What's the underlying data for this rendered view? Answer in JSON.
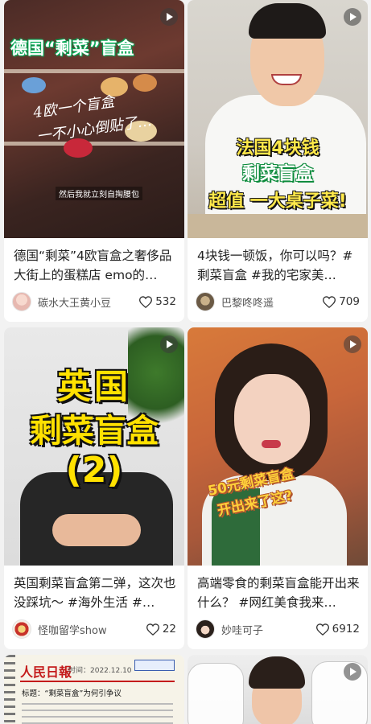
{
  "feed": {
    "cards": [
      {
        "title": "德国“剩菜”4欧盲盒之奢侈品大街上的蛋糕店 emo的…",
        "author": "碳水大王黄小豆",
        "likes": "532",
        "thumb_text": {
          "headline": "德国“剩菜”盲盒",
          "note_line1": "4欧一个盲盒",
          "note_line2": "一不小心倒贴了…",
          "subtitle": "然后我就立刻自掏腰包"
        }
      },
      {
        "title": "4块钱一顿饭，你可以吗？#剩菜盲盒 #我的宅家美…",
        "author": "巴黎咚咚遥",
        "likes": "709",
        "thumb_text": {
          "line1": "法国4块钱",
          "line2": "剩菜盲盒",
          "line3": "超值 一大桌子菜!"
        }
      },
      {
        "title": "英国剩菜盲盒第二弹，这次也没踩坑～ #海外生活 #…",
        "author": "怪咖留学show",
        "likes": "22",
        "thumb_text": {
          "line1": "英国",
          "line2": "剩菜盲盒",
          "line3": "(2)"
        }
      },
      {
        "title": "高端零食的剩菜盲盒能开出来什么？ #网红美食我来…",
        "author": "妙哇可子",
        "likes": "6912",
        "thumb_text": {
          "line1": "50元剩菜盲盒",
          "line2": "开出来了这?"
        }
      },
      {
        "thumb_text": {
          "masthead": "人民日報",
          "date": "时间：2022.12.10",
          "headline": "标题：“剩菜盲盒”为何引争议"
        }
      },
      {}
    ]
  },
  "colors": {
    "background": "#f2f2f2",
    "card": "#ffffff",
    "accent_yellow": "#ffe100",
    "text": "#222222"
  },
  "icons": {
    "play": "play-icon",
    "like": "heart-outline-icon"
  }
}
